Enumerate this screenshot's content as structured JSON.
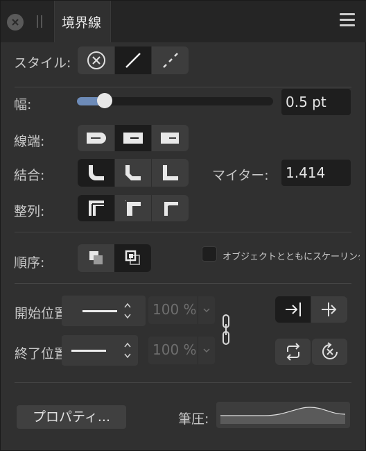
{
  "panel": {
    "tab_title": "境界線"
  },
  "style_row": {
    "label": "スタイル:",
    "options": [
      "none",
      "solid",
      "dashed"
    ],
    "selected": "solid"
  },
  "width_row": {
    "label": "幅:",
    "value": "0.5 pt",
    "slider_level": 0.14
  },
  "cap_row": {
    "label": "線端:",
    "selected": "square"
  },
  "join_row": {
    "label": "結合:",
    "selected": "round",
    "miter_label": "マイター:",
    "miter_value": "1.414"
  },
  "align_row": {
    "label": "整列:",
    "selected": "center"
  },
  "order_row": {
    "label": "順序:",
    "selected": "front",
    "scale_checkbox_label": "オブジェクトとともにスケーリング",
    "scale_checked": false
  },
  "arrows": {
    "start_label": "開始位置:",
    "end_label": "終了位置",
    "start_scale": "100 %",
    "end_scale": "100 %"
  },
  "footer": {
    "properties_button": "プロパティ...",
    "pressure_label": "筆圧:"
  },
  "colors": {
    "accent": "#6d8bb8",
    "panel_bg": "#303030",
    "field_bg": "#1e1e1e"
  }
}
